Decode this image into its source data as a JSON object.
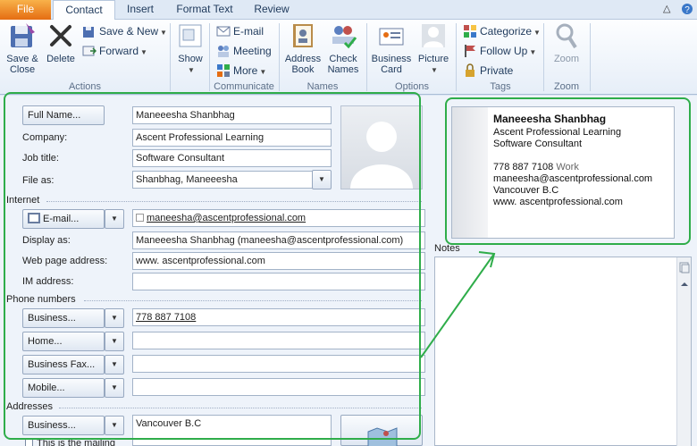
{
  "tabs": {
    "file": "File",
    "contact": "Contact",
    "insert": "Insert",
    "format_text": "Format Text",
    "review": "Review"
  },
  "ribbon": {
    "actions": {
      "save_close": "Save &",
      "save_close_2": "Close",
      "delete": "Delete",
      "save_new": "Save & New",
      "forward": "Forward",
      "label": "Actions"
    },
    "show": {
      "show": "Show",
      "label": ""
    },
    "communicate": {
      "email": "E-mail",
      "meeting": "Meeting",
      "more": "More",
      "label": "Communicate"
    },
    "names": {
      "address_book": "Address",
      "address_book_2": "Book",
      "check_names": "Check",
      "check_names_2": "Names",
      "label": "Names"
    },
    "options": {
      "business_card": "Business",
      "business_card_2": "Card",
      "picture": "Picture",
      "label": "Options"
    },
    "tags": {
      "categorize": "Categorize",
      "follow_up": "Follow Up",
      "private": "Private",
      "label": "Tags"
    },
    "zoom": {
      "zoom": "Zoom",
      "label": "Zoom"
    }
  },
  "form": {
    "full_name_btn": "Full Name...",
    "full_name": "Maneeesha Shanbhag",
    "company_lbl": "Company:",
    "company": "Ascent Professional Learning",
    "job_title_lbl": "Job title:",
    "job_title": "Software Consultant",
    "file_as_lbl": "File as:",
    "file_as": "Shanbhag, Maneeesha",
    "internet_section": "Internet",
    "email_btn": "E-mail...",
    "email": "maneesha@ascentprofessional.com",
    "display_as_lbl": "Display as:",
    "display_as": "Maneeesha Shanbhag (maneesha@ascentprofessional.com)",
    "web_page_lbl": "Web page address:",
    "web_page": "www. ascentprofessional.com",
    "im_lbl": "IM address:",
    "im": "",
    "phone_section": "Phone numbers",
    "phone_business_btn": "Business...",
    "phone_business": "778 887 7108",
    "phone_home_btn": "Home...",
    "phone_home": "",
    "phone_fax_btn": "Business Fax...",
    "phone_fax": "",
    "phone_mobile_btn": "Mobile...",
    "phone_mobile": "",
    "addresses_section": "Addresses",
    "address_business_btn": "Business...",
    "address": "Vancouver B.C",
    "mailing_check": "This is the mailing"
  },
  "card": {
    "name": "Maneeesha Shanbhag",
    "company": "Ascent Professional Learning",
    "title": "Software Consultant",
    "phone": "778 887 7108",
    "phone_type": "Work",
    "email": "maneesha@ascentprofessional.com",
    "address": "Vancouver B.C",
    "web": "www. ascentprofessional.com"
  },
  "notes_label": "Notes",
  "colors": {
    "highlight": "#2fad4a",
    "file_tab": "#e56d12"
  }
}
